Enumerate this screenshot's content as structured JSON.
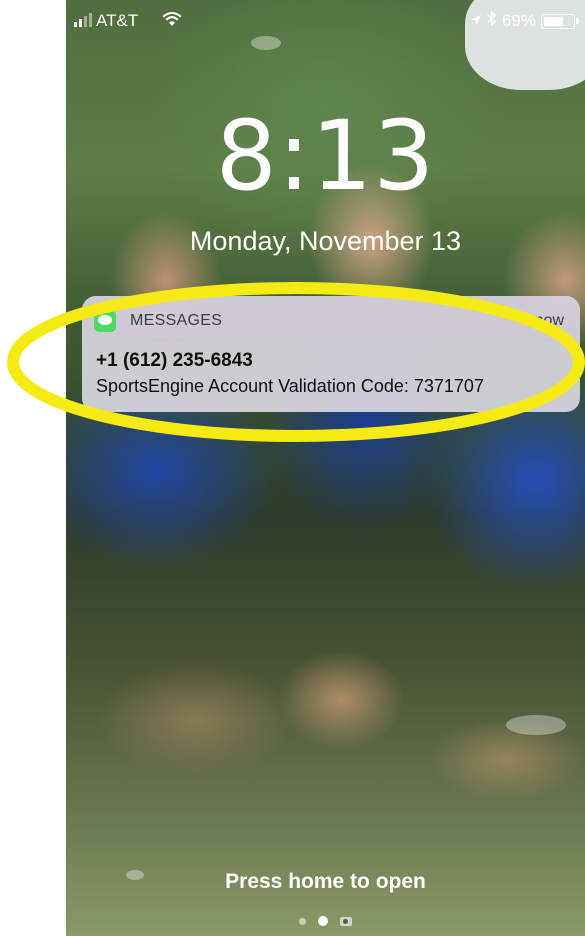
{
  "status_bar": {
    "carrier": "AT&T",
    "wifi_icon": "wifi-icon",
    "location_icon": "location-arrow-icon",
    "bluetooth_icon": "bluetooth-icon",
    "battery_percent": "69%",
    "battery_level": 0.69,
    "signal_bars": 2
  },
  "lock_screen": {
    "time": "8:13",
    "date": "Monday, November 13",
    "hint": "Press home to open"
  },
  "notification": {
    "app_name": "MESSAGES",
    "time": "now",
    "sender": "+1 (612) 235-6843",
    "message": "SportsEngine Account Validation Code: 7371707",
    "app_icon": "messages-app-icon"
  },
  "page_indicator": {
    "dots": 2,
    "active_index": 1,
    "camera_icon": "camera-icon"
  },
  "colors": {
    "annotation": "#f5ea13",
    "messages_green": "#4cd964"
  }
}
